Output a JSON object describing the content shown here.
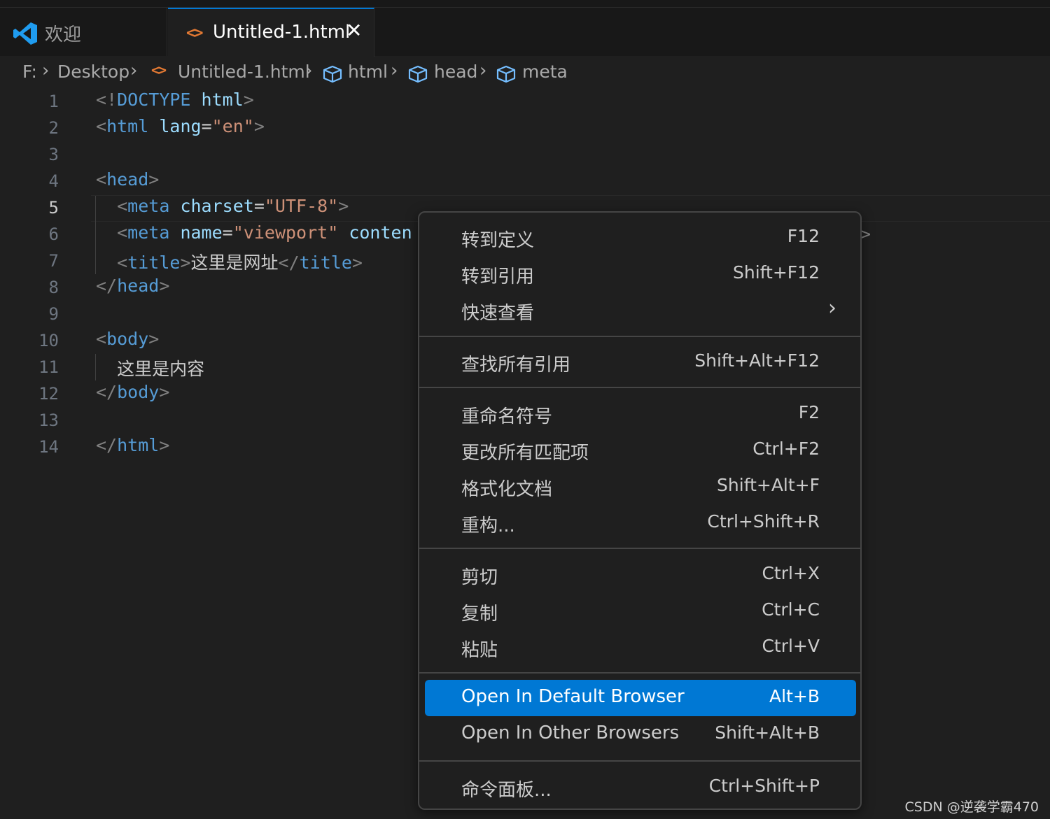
{
  "tabs": {
    "welcome_label": "欢迎",
    "active_label": "Untitled-1.html",
    "close_glyph": "✕"
  },
  "breadcrumb": {
    "drive": "F:",
    "folder": "Desktop",
    "file": "Untitled-1.html",
    "sym1": "html",
    "sym2": "head",
    "sym3": "meta",
    "sep": "›"
  },
  "editor": {
    "active_line": 5,
    "line_numbers": [
      "1",
      "2",
      "3",
      "4",
      "5",
      "6",
      "7",
      "8",
      "9",
      "10",
      "11",
      "12",
      "13",
      "14"
    ],
    "lines": [
      "<!DOCTYPE html>",
      "<html lang=\"en\">",
      "",
      "<head>",
      "  <meta charset=\"UTF-8\">",
      "  <meta name=\"viewport\" conten",
      "  <title>这里是网址</title>",
      "</head>",
      "",
      "<body>",
      "  这里是内容",
      "</body>",
      "",
      "</html>"
    ]
  },
  "context_menu": {
    "items": [
      {
        "label": "转到定义",
        "shortcut": "F12"
      },
      {
        "label": "转到引用",
        "shortcut": "Shift+F12"
      },
      {
        "label": "快速查看",
        "shortcut": "",
        "submenu": "›"
      },
      {
        "label": "查找所有引用",
        "shortcut": "Shift+Alt+F12"
      },
      {
        "label": "重命名符号",
        "shortcut": "F2"
      },
      {
        "label": "更改所有匹配项",
        "shortcut": "Ctrl+F2"
      },
      {
        "label": "格式化文档",
        "shortcut": "Shift+Alt+F"
      },
      {
        "label": "重构...",
        "shortcut": "Ctrl+Shift+R"
      },
      {
        "label": "剪切",
        "shortcut": "Ctrl+X"
      },
      {
        "label": "复制",
        "shortcut": "Ctrl+C"
      },
      {
        "label": "粘贴",
        "shortcut": "Ctrl+V"
      },
      {
        "label": "Open In Default Browser",
        "shortcut": "Alt+B",
        "selected": true
      },
      {
        "label": "Open In Other Browsers",
        "shortcut": "Shift+Alt+B"
      },
      {
        "label": "命令面板...",
        "shortcut": "Ctrl+Shift+P"
      }
    ]
  },
  "overflow_char": ">",
  "watermark": "CSDN @逆袭学霸470",
  "colors": {
    "accent": "#0078d4",
    "tag": "#569cd6",
    "attribute": "#9cdcfe",
    "string": "#ce9178",
    "html_file_icon": "#e37933",
    "symbol_icon": "#75beff"
  },
  "icons": {
    "vscode_logo": "vscode-logo-icon",
    "html_file": "html-file-icon",
    "symbol": "symbol-cube-icon"
  }
}
